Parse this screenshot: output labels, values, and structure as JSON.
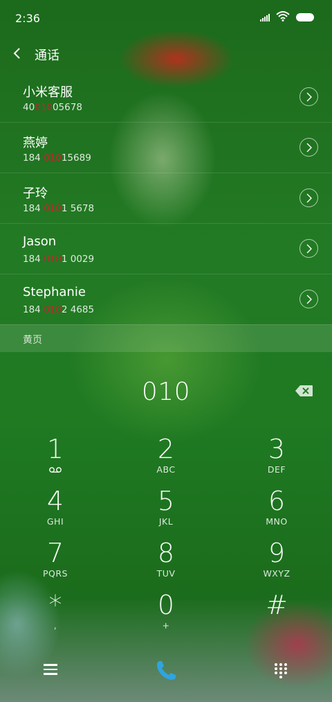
{
  "status": {
    "time": "2:36"
  },
  "header": {
    "title": "通话"
  },
  "contacts": [
    {
      "name": "小米客服",
      "pre": "40",
      "match": "010",
      "post": "05678"
    },
    {
      "name": "燕婷",
      "pre": "184 ",
      "match": "010",
      "post": "15689"
    },
    {
      "name": "子玲",
      "pre": "184 ",
      "match": "010",
      "post": "1 5678"
    },
    {
      "name": "Jason",
      "pre": "184 ",
      "match": "010",
      "post": "1 0029"
    },
    {
      "name": "Stephanie",
      "pre": "184 ",
      "match": "010",
      "post": "2 4685"
    }
  ],
  "yellow_pages": {
    "label": "黄页"
  },
  "dialer": {
    "input": "010",
    "keys": [
      {
        "digit": "1",
        "letters": "voicemail-icon"
      },
      {
        "digit": "2",
        "letters": "ABC"
      },
      {
        "digit": "3",
        "letters": "DEF"
      },
      {
        "digit": "4",
        "letters": "GHI"
      },
      {
        "digit": "5",
        "letters": "JKL"
      },
      {
        "digit": "6",
        "letters": "MNO"
      },
      {
        "digit": "7",
        "letters": "PQRS"
      },
      {
        "digit": "8",
        "letters": "TUV"
      },
      {
        "digit": "9",
        "letters": "WXYZ"
      },
      {
        "digit": "*",
        "letters": ","
      },
      {
        "digit": "0",
        "letters": "+"
      },
      {
        "digit": "#",
        "letters": ""
      }
    ]
  },
  "colors": {
    "match_highlight": "#c8222c",
    "call_button": "#2fa4e0"
  },
  "icons": [
    "back-icon",
    "signal-icon",
    "wifi-icon",
    "battery-icon",
    "chevron-right-icon",
    "delete-icon",
    "menu-icon",
    "phone-icon",
    "dialpad-icon"
  ]
}
